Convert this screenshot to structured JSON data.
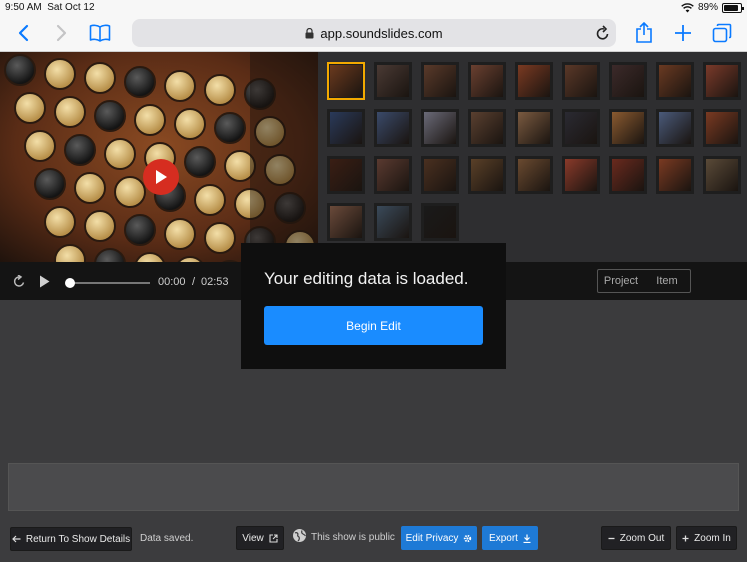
{
  "status_bar": {
    "time": "9:50 AM",
    "date": "Sat Oct 12",
    "battery": "89%",
    "battery_level": 0.89
  },
  "browser": {
    "url": "app.soundslides.com"
  },
  "player": {
    "current_time": "00:00",
    "separator": "/",
    "duration": "02:53",
    "progress": 0
  },
  "tabs": {
    "project": "Project",
    "item": "Item"
  },
  "thumbnails": [
    {
      "color": "#6b3a1e",
      "selected": true
    },
    {
      "color": "#4a3a34"
    },
    {
      "color": "#5a3a2a"
    },
    {
      "color": "#6a4030"
    },
    {
      "color": "#7a3a22"
    },
    {
      "color": "#5a3828"
    },
    {
      "color": "#3c2a2a"
    },
    {
      "color": "#6a3a22"
    },
    {
      "color": "#7a3a2a"
    },
    {
      "color": "#2a3a5a"
    },
    {
      "color": "#3a4a6a"
    },
    {
      "color": "#6a6a78"
    },
    {
      "color": "#5a4030"
    },
    {
      "color": "#7a5a40"
    },
    {
      "color": "#2a2a32"
    },
    {
      "color": "#8a5a30"
    },
    {
      "color": "#4a5a7a"
    },
    {
      "color": "#7a3a22"
    },
    {
      "color": "#3a1e14"
    },
    {
      "color": "#5a3a30"
    },
    {
      "color": "#4a3020"
    },
    {
      "color": "#5a4028"
    },
    {
      "color": "#6a4a30"
    },
    {
      "color": "#8a3a2a"
    },
    {
      "color": "#6a2a1e"
    },
    {
      "color": "#7a3a22"
    },
    {
      "color": "#5a4a38"
    },
    {
      "color": "#6a4a3a"
    },
    {
      "color": "#3a4a5a"
    },
    {
      "color": "#1a1a1a"
    }
  ],
  "modal": {
    "message": "Your editing data is loaded.",
    "button": "Begin Edit"
  },
  "footer": {
    "return_label": "Return To Show Details",
    "saved_text": "Data saved.",
    "view_label": "View",
    "public_text": "This show is public",
    "privacy_label": "Edit Privacy",
    "export_label": "Export",
    "zoom_out_label": "Zoom Out",
    "zoom_in_label": "Zoom In"
  },
  "colors": {
    "accent_blue": "#1a8cff",
    "selection": "#f2a900",
    "play_button": "#d62d20"
  }
}
